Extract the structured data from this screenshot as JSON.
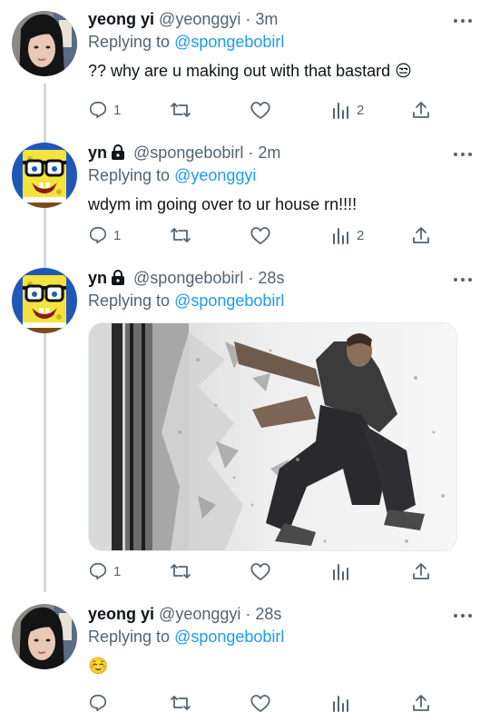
{
  "tweets": [
    {
      "name": "yeong yi",
      "handle": "@yeonggyi",
      "time": "3m",
      "reply_prefix": "Replying to",
      "reply_to": "@spongebobirl",
      "text": "?? why are u making out with that bastard 😒",
      "replies": "1",
      "views": "2",
      "avatar": "girl-photo"
    },
    {
      "name": "yn",
      "handle": "@spongebobirl",
      "time": "2m",
      "reply_prefix": "Replying to",
      "reply_to": "@yeonggyi",
      "text": "wdym im going over to ur house rn!!!!",
      "replies": "1",
      "views": "2",
      "avatar": "spongebob-glasses"
    },
    {
      "name": "yn",
      "handle": "@spongebobirl",
      "time": "28s",
      "reply_prefix": "Replying to",
      "reply_to": "@spongebobirl",
      "text": "",
      "replies": "1",
      "views": "",
      "avatar": "spongebob-glasses",
      "media": "man-crashing-through-glass-wall"
    },
    {
      "name": "yeong yi",
      "handle": "@yeonggyi",
      "time": "28s",
      "reply_prefix": "Replying to",
      "reply_to": "@spongebobirl",
      "text": "☺️",
      "replies": "",
      "views": "",
      "avatar": "girl-photo"
    }
  ],
  "colors": {
    "link": "#1d9bf0",
    "secondary": "#536471",
    "thread_line": "#cfd9de"
  }
}
